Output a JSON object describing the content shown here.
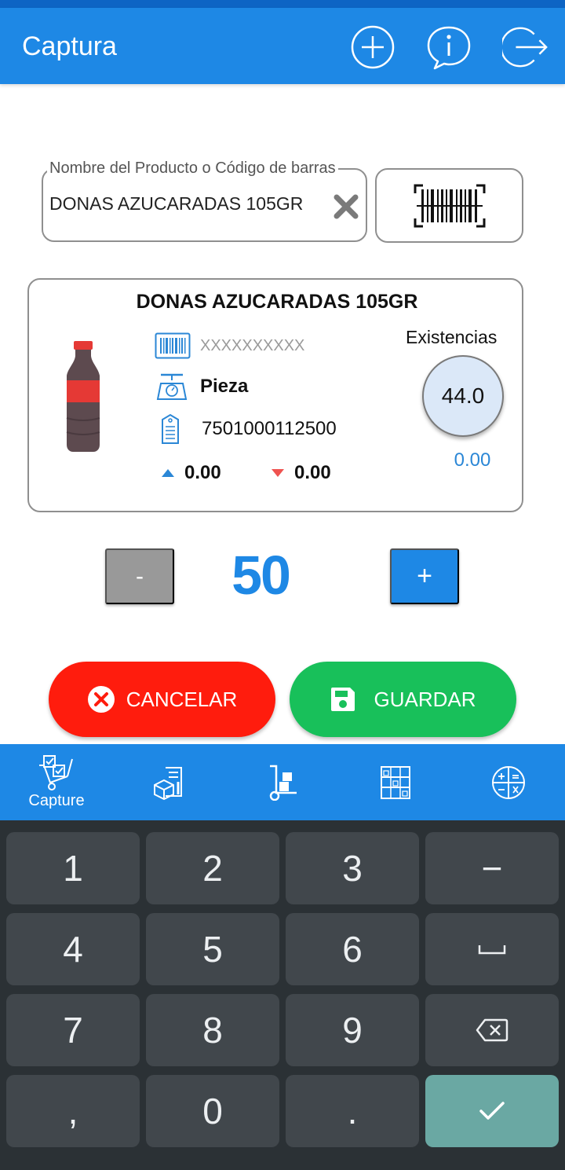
{
  "appbar": {
    "title": "Captura",
    "icons": [
      "add-circle-icon",
      "info-chat-icon",
      "logout-icon"
    ],
    "color": "#1e88e5"
  },
  "search": {
    "label": "Nombre del Producto o Código de barras",
    "value": "DONAS AZUCARADAS 105GR",
    "clear_icon": "close-icon",
    "scan_icon": "barcode-scan-icon"
  },
  "product": {
    "name": "DONAS AZUCARADAS 105GR",
    "image_icon": "soda-bottle-icon",
    "sku": "XXXXXXXXXX",
    "unit": "Pieza",
    "code": "7501000112500",
    "delta_up": "0.00",
    "delta_down": "0.00",
    "stock_label": "Existencias",
    "stock_value": "44.0",
    "stock_secondary": "0.00"
  },
  "quantity": {
    "minus_label": "-",
    "value": "50",
    "plus_label": "+"
  },
  "actions": {
    "cancel_label": "CANCELAR",
    "save_label": "GUARDAR",
    "cancel_color": "#ff1c0d",
    "save_color": "#18c05a"
  },
  "bottom_nav": {
    "items": [
      {
        "label": "Capture",
        "icon": "capture-cart-icon"
      },
      {
        "label": "",
        "icon": "inventory-report-icon"
      },
      {
        "label": "",
        "icon": "hand-truck-icon"
      },
      {
        "label": "",
        "icon": "shelves-icon"
      },
      {
        "label": "",
        "icon": "calculator-circle-icon"
      }
    ]
  },
  "keyboard": {
    "keys": [
      "1",
      "2",
      "3",
      "−",
      "4",
      "5",
      "6",
      "␣",
      "7",
      "8",
      "9",
      "⌫",
      ",",
      "0",
      ".",
      "✓"
    ]
  }
}
